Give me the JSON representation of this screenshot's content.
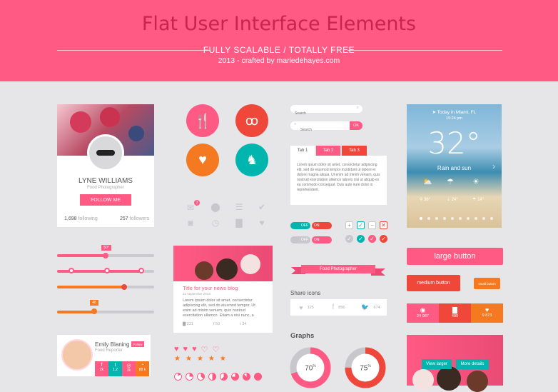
{
  "header": {
    "title": "Flat User Interface Elements",
    "subtitle": "FULLY SCALABLE / TOTALLY FREE",
    "credit": "2013 - crafted by mariedehayes.com"
  },
  "profile": {
    "name": "LYNE WILLIAMS",
    "role": "Food Photographer",
    "follow": "FOLLOW ME",
    "following_count": "1,698",
    "following_label": "following",
    "followers_count": "257",
    "followers_label": "followers"
  },
  "sliders": {
    "tooltip1": "50°",
    "tooltip2": "48"
  },
  "contact": {
    "name": "Emily Blaning",
    "badge": "Follow",
    "role": "Food Reporter",
    "stats": [
      "2k",
      "1.2",
      "3k",
      "88 k"
    ],
    "colors": [
      "#ff5a84",
      "#00b5ad",
      "#ff5a84",
      "#f47920"
    ]
  },
  "blog": {
    "title": "Title for your news blog",
    "date": "22 september 2013",
    "body": "Lorem ipsum dolor sit amet, consectetur adipiscing elit, sed do eiusmod tempor. Ut enim ad minim veniam, quis nostrud exercitation ullamco. Etiam a nisi nunc, a tincidunt eros.",
    "c1": "221",
    "c2": "50",
    "c3": "34"
  },
  "search": {
    "placeholder1": "Search",
    "placeholder2": "Search",
    "ok": "OK"
  },
  "tabs": {
    "t1": "Tab 1",
    "t2": "Tab 2",
    "t3": "Tab 3",
    "text": "Lorem ipsum dolor sit amet, consectetur adipiscing elit, sed do eiusmod tempor incididunt ut labore et dolore magna aliqua. Ut enim ad minim veniam, quis nostrud exercitation ullamco laboris nisi ut aliquip ex ea commodo consequat. Duis aute irure dolor in reprehenderit."
  },
  "toggles": {
    "off": "OFF",
    "on": "ON"
  },
  "ribbon": {
    "label": "Food Photographer"
  },
  "share": {
    "title": "Share icons",
    "c1": "125",
    "c2": "856",
    "c3": "674"
  },
  "graphs": {
    "title": "Graphs",
    "v1": "70",
    "v2": "75",
    "unit": "%",
    "p1": 0.7,
    "p2": 0.75
  },
  "weather": {
    "location": "Today in Miami, FL",
    "time": "15:24 pm",
    "temp": "32°",
    "desc": "Rain and sun",
    "f1": "36°",
    "f2": "24°",
    "f3": "14°"
  },
  "buttons": {
    "large": "large button",
    "medium": "medium button",
    "small": "small button"
  },
  "stats": {
    "s1": "24 987",
    "s2": "489",
    "s3": "9 873"
  },
  "photo": {
    "view": "View larger",
    "more": "More details"
  },
  "notif": {
    "count": "3"
  },
  "colors": {
    "pink": "#ff5a84",
    "red": "#f0473b",
    "orange": "#f47920",
    "teal": "#00b5ad",
    "gray": "#c7c7cc"
  }
}
